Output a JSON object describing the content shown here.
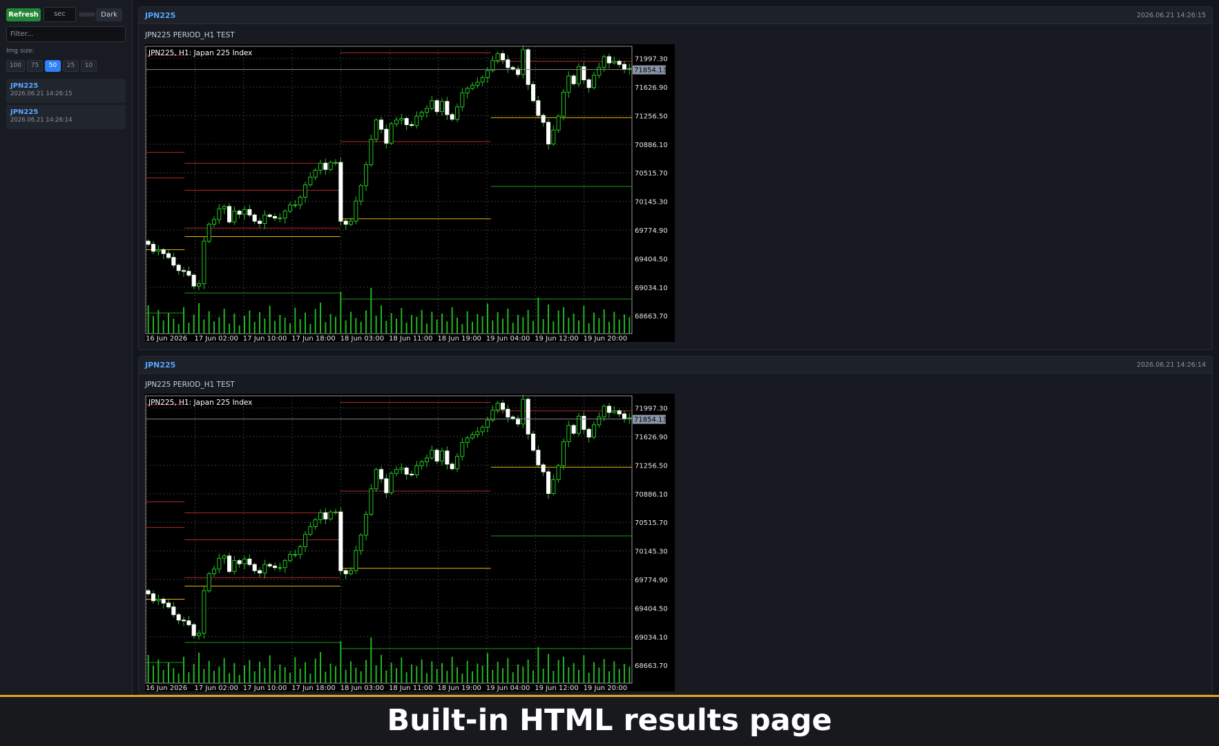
{
  "sidebar": {
    "refresh_label": "Refresh",
    "seconds_placeholder": "sec",
    "theme_label": "Dark",
    "filter_placeholder": "Filter...",
    "img_size_label": "Img size:",
    "img_sizes": [
      "100",
      "75",
      "50",
      "25",
      "10"
    ],
    "img_size_selected": "50",
    "history": [
      {
        "title": "JPN225",
        "date": "2026.06.21 14:26:15"
      },
      {
        "title": "JPN225",
        "date": "2026.06.21 14:26:14"
      }
    ]
  },
  "results": [
    {
      "title": "JPN225",
      "timestamp": "2026.06.21 14:26:15",
      "subtitle": "JPN225 PERIOD_H1 TEST"
    },
    {
      "title": "JPN225",
      "timestamp": "2026.06.21 14:26:14",
      "subtitle": "JPN225 PERIOD_H1 TEST"
    }
  ],
  "chart_data": {
    "type": "candlestick",
    "title": "JPN225, H1:  Japan 225 Index",
    "current_price": "71854.13",
    "ylim": [
      68433,
      72155
    ],
    "y_ticks": [
      "71997.30",
      "71626.90",
      "71256.50",
      "70886.10",
      "70515.70",
      "70145.30",
      "69774.90",
      "69404.50",
      "69034.10",
      "68663.70"
    ],
    "x_ticks": [
      "16 Jun 2026",
      "17 Jun 02:00",
      "17 Jun 10:00",
      "17 Jun 18:00",
      "18 Jun 03:00",
      "18 Jun 11:00",
      "18 Jun 19:00",
      "19 Jun 04:00",
      "19 Jun 12:00",
      "19 Jun 20:00"
    ],
    "closes": [
      69590,
      69500,
      69520,
      69470,
      69420,
      69320,
      69250,
      69240,
      69190,
      69050,
      69080,
      69630,
      69850,
      69910,
      70050,
      70080,
      69880,
      70020,
      69980,
      70040,
      69970,
      69890,
      69860,
      69970,
      69950,
      69930,
      69930,
      70020,
      70100,
      70100,
      70200,
      70360,
      70460,
      70550,
      70640,
      70560,
      70650,
      70650,
      69890,
      69850,
      69890,
      70150,
      70350,
      70620,
      70950,
      71200,
      71080,
      70900,
      71150,
      71200,
      71220,
      71140,
      71130,
      71250,
      71300,
      71350,
      71450,
      71310,
      71440,
      71270,
      71210,
      71370,
      71550,
      71610,
      71650,
      71690,
      71750,
      71840,
      71970,
      72060,
      71980,
      71880,
      71860,
      71790,
      72110,
      71660,
      71450,
      71260,
      71170,
      70890,
      71070,
      71250,
      71560,
      71770,
      71670,
      71890,
      71720,
      71620,
      71780,
      71880,
      72020,
      71940,
      71960,
      71920,
      71860,
      71870
    ],
    "volumes": [
      0.62,
      0.38,
      0.52,
      0.29,
      0.45,
      0.33,
      0.21,
      0.58,
      0.24,
      0.42,
      0.67,
      0.31,
      0.49,
      0.27,
      0.36,
      0.55,
      0.22,
      0.44,
      0.18,
      0.39,
      0.51,
      0.26,
      0.47,
      0.33,
      0.61,
      0.28,
      0.41,
      0.35,
      0.23,
      0.57,
      0.32,
      0.46,
      0.21,
      0.54,
      0.68,
      0.25,
      0.43,
      0.37,
      0.92,
      0.29,
      0.48,
      0.34,
      0.26,
      0.51,
      1.0,
      0.39,
      0.62,
      0.28,
      0.45,
      0.33,
      0.56,
      0.24,
      0.41,
      0.37,
      0.52,
      0.22,
      0.48,
      0.31,
      0.44,
      0.27,
      0.58,
      0.35,
      0.21,
      0.49,
      0.26,
      0.43,
      0.38,
      0.66,
      0.29,
      0.47,
      0.33,
      0.55,
      0.24,
      0.41,
      0.36,
      0.52,
      0.28,
      0.79,
      0.32,
      0.64,
      0.27,
      0.51,
      0.58,
      0.35,
      0.44,
      0.29,
      0.61,
      0.23,
      0.46,
      0.34,
      0.53,
      0.26,
      0.48,
      0.31,
      0.42,
      0.36
    ]
  },
  "caption": "Built-in HTML results page"
}
